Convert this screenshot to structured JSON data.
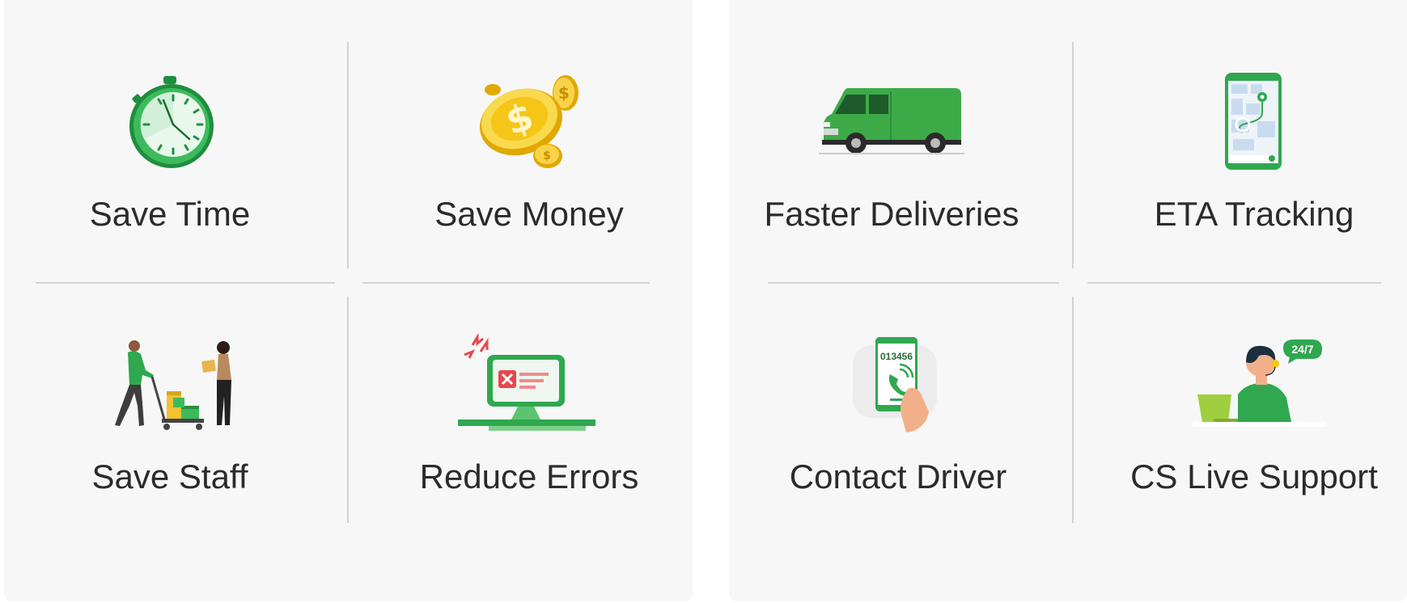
{
  "panels": [
    {
      "name": "left",
      "features": [
        {
          "label": "Save Time",
          "icon": "stopwatch-icon"
        },
        {
          "label": "Save Money",
          "icon": "coins-icon"
        },
        {
          "label": "Save Staff",
          "icon": "delivery-staff-icon"
        },
        {
          "label": "Reduce Errors",
          "icon": "error-monitor-icon"
        }
      ]
    },
    {
      "name": "right",
      "features": [
        {
          "label": "Faster Deliveries",
          "icon": "van-icon"
        },
        {
          "label": "ETA Tracking",
          "icon": "map-phone-icon"
        },
        {
          "label": "Contact Driver",
          "icon": "phone-call-icon",
          "phone_text": "013456"
        },
        {
          "label": "CS Live Support",
          "icon": "support-agent-icon",
          "badge_text": "24/7"
        }
      ]
    }
  ],
  "colors": {
    "panel_bg": "#f7f7f7",
    "divider": "#d3d3d3",
    "text": "#2b2b2b",
    "brand_green": "#2fa84f",
    "coin_gold": "#f5c518",
    "error_red": "#e8474c"
  }
}
